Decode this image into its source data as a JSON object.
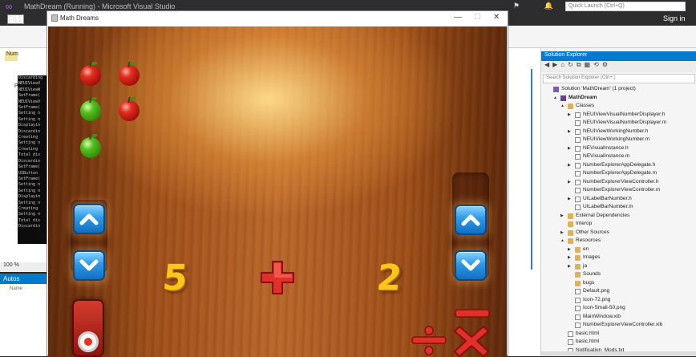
{
  "vs": {
    "title": "MathDream (Running) - Microsoft Visual Studio",
    "menu_file": "FILE",
    "quick_launch_placeholder": "Quick Launch (Ctrl+Q)",
    "sign_in": "Sign in",
    "doc_tab": "Num",
    "project_tab": "Pr",
    "zoom": "100 %",
    "autos_title": "Autos",
    "autos_col": "Name",
    "console_lines": [
      "Discarding",
      "NEUIViewV",
      "NEUIViewW",
      "SetFrame(",
      "NEUIViewV",
      "SetFrame(",
      "Setting n",
      "Setting n",
      "Displayin",
      "Discardin",
      "Creating",
      "Setting n",
      "Creating",
      "Total dis",
      "Discardin",
      "SetFrame(",
      "UIButton",
      "SetFrame(",
      "Setting n",
      "Setting n",
      "Displayin",
      "Setting n",
      "Creating",
      "Setting n",
      "Total dis",
      "Discardin"
    ],
    "code_frags": [
      "c",
      "[",
      "t"
    ]
  },
  "sim": {
    "title": "Math Dreams",
    "first_number": "5",
    "second_number": "2",
    "operator": "plus",
    "apples": [
      {
        "color": "red"
      },
      {
        "color": "red"
      },
      {
        "color": "green"
      },
      {
        "color": "red"
      },
      {
        "color": "green"
      }
    ]
  },
  "solution_explorer": {
    "title": "Solution Explorer",
    "search_placeholder": "Search Solution Explorer (Ctrl+;)",
    "items": [
      {
        "label": "Solution 'MathDream' (1 project)",
        "depth": 0,
        "kind": "sol",
        "expander": ""
      },
      {
        "label": "MathDream",
        "depth": 1,
        "kind": "proj",
        "expander": "▲",
        "selected": true
      },
      {
        "label": "Classes",
        "depth": 2,
        "kind": "folder",
        "expander": "▲"
      },
      {
        "label": "NEUIViewVisualNumberDisplayer.h",
        "depth": 3,
        "kind": "file",
        "expander": "▶"
      },
      {
        "label": "NEUIViewVisualNumberDisplayer.m",
        "depth": 3,
        "kind": "file",
        "expander": ""
      },
      {
        "label": "NEUIViewWorkingNumber.h",
        "depth": 3,
        "kind": "file",
        "expander": "▶"
      },
      {
        "label": "NEUIViewWorkingNumber.m",
        "depth": 3,
        "kind": "file",
        "expander": ""
      },
      {
        "label": "NEVisualInstance.h",
        "depth": 3,
        "kind": "file",
        "expander": "▶"
      },
      {
        "label": "NEVisualInstance.m",
        "depth": 3,
        "kind": "file",
        "expander": ""
      },
      {
        "label": "NumberExplorerAppDelegate.h",
        "depth": 3,
        "kind": "file",
        "expander": "▶"
      },
      {
        "label": "NumberExplorerAppDelegate.m",
        "depth": 3,
        "kind": "file",
        "expander": ""
      },
      {
        "label": "NumberExplorerViewController.h",
        "depth": 3,
        "kind": "file",
        "expander": "▶"
      },
      {
        "label": "NumberExplorerViewController.m",
        "depth": 3,
        "kind": "file",
        "expander": ""
      },
      {
        "label": "UILabelBarNumber.h",
        "depth": 3,
        "kind": "file",
        "expander": "▶"
      },
      {
        "label": "UILabelBarNumber.m",
        "depth": 3,
        "kind": "file",
        "expander": ""
      },
      {
        "label": "External Dependencies",
        "depth": 2,
        "kind": "folder",
        "expander": "▶"
      },
      {
        "label": "Interop",
        "depth": 2,
        "kind": "folder",
        "expander": ""
      },
      {
        "label": "Other Sources",
        "depth": 2,
        "kind": "folder",
        "expander": "▶"
      },
      {
        "label": "Resources",
        "depth": 2,
        "kind": "folder",
        "expander": "▲"
      },
      {
        "label": "en",
        "depth": 3,
        "kind": "folder",
        "expander": "▶"
      },
      {
        "label": "Images",
        "depth": 3,
        "kind": "folder",
        "expander": "▶"
      },
      {
        "label": "ja",
        "depth": 3,
        "kind": "folder",
        "expander": "▶"
      },
      {
        "label": "Sounds",
        "depth": 3,
        "kind": "folder",
        "expander": ""
      },
      {
        "label": "bugs",
        "depth": 3,
        "kind": "folder",
        "expander": ""
      },
      {
        "label": "Default.png",
        "depth": 3,
        "kind": "file",
        "expander": ""
      },
      {
        "label": "Icon-72.png",
        "depth": 3,
        "kind": "file",
        "expander": ""
      },
      {
        "label": "Icon-Small-50.png",
        "depth": 3,
        "kind": "file",
        "expander": ""
      },
      {
        "label": "MainWindow.xib",
        "depth": 3,
        "kind": "file",
        "expander": ""
      },
      {
        "label": "NumberExplorerViewController.xib",
        "depth": 3,
        "kind": "file",
        "expander": ""
      },
      {
        "label": "basic.html",
        "depth": 2,
        "kind": "file",
        "expander": ""
      },
      {
        "label": "basic.html",
        "depth": 2,
        "kind": "file",
        "expander": ""
      },
      {
        "label": "Notification_Mods.txt",
        "depth": 2,
        "kind": "file",
        "expander": ""
      }
    ]
  }
}
